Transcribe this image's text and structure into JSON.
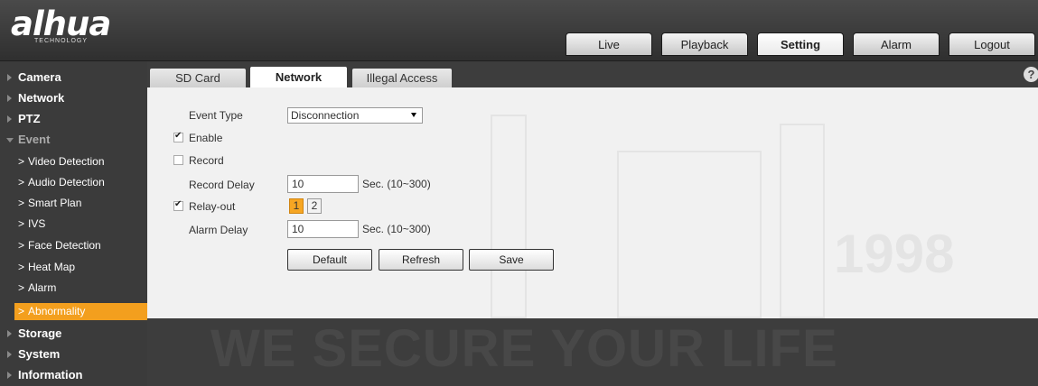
{
  "logo": {
    "brand": "alhua",
    "tagline": "TECHNOLOGY"
  },
  "topnav": [
    {
      "label": "Live",
      "active": false
    },
    {
      "label": "Playback",
      "active": false
    },
    {
      "label": "Setting",
      "active": true
    },
    {
      "label": "Alarm",
      "active": false
    },
    {
      "label": "Logout",
      "active": false
    }
  ],
  "sidebar": {
    "camera": "Camera",
    "network": "Network",
    "ptz": "PTZ",
    "event": "Event",
    "event_items": [
      "Video Detection",
      "Audio Detection",
      "Smart Plan",
      "IVS",
      "Face Detection",
      "Heat Map",
      "Alarm",
      "Abnormality"
    ],
    "storage": "Storage",
    "system": "System",
    "information": "Information"
  },
  "tabs": [
    {
      "label": "SD Card",
      "active": false
    },
    {
      "label": "Network",
      "active": true
    },
    {
      "label": "Illegal Access",
      "active": false
    }
  ],
  "help_label": "?",
  "form": {
    "event_type_label": "Event Type",
    "event_type_value": "Disconnection",
    "enable_label": "Enable",
    "enable_checked": true,
    "record_label": "Record",
    "record_checked": false,
    "record_delay_label": "Record Delay",
    "record_delay_value": "10",
    "record_delay_unit": "Sec. (10~300)",
    "relay_out_label": "Relay-out",
    "relay_out_checked": true,
    "relay_1": "1",
    "relay_2": "2",
    "alarm_delay_label": "Alarm Delay",
    "alarm_delay_value": "10",
    "alarm_delay_unit": "Sec. (10~300)"
  },
  "buttons": {
    "default": "Default",
    "refresh": "Refresh",
    "save": "Save"
  },
  "watermark": {
    "slogan": "WE SECURE YOUR LIFE",
    "year": "1998"
  },
  "colors": {
    "accent": "#f39f1e",
    "relay_active": "#f6a623"
  }
}
